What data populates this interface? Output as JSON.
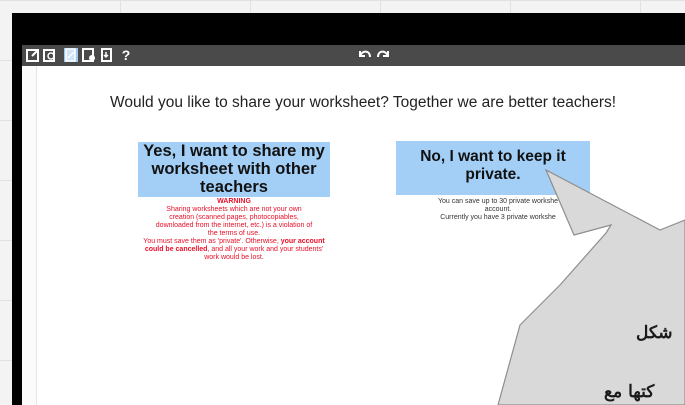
{
  "toolbar": {
    "icons": [
      "edit-icon",
      "preview-icon",
      "share-icon",
      "settings-icon",
      "export-icon"
    ],
    "help_label": "?",
    "undo_icon": "undo-icon",
    "redo_icon": "redo-icon"
  },
  "main": {
    "question": "Would you like to share your worksheet? Together we are better teachers!",
    "share_button": "Yes, I want to share my worksheet with other teachers",
    "private_button": "No, I want to keep it private.",
    "warning": {
      "title": "WARNING",
      "lines": [
        "Sharing worksheets which are not your own",
        "creation (scanned pages, photocopiables,",
        "downloaded from the internet, etc.) is a violation of",
        "the terms of use."
      ],
      "must_save": "You must save them as 'private'. Otherwise,",
      "cancelled_bold": "your account could be cancelled",
      "rest": ", and all your work and your students' work would be lost."
    },
    "private_info": {
      "line1": "You can save up to 30 private workshe",
      "line2": "account.",
      "line3": "Currently you have 3 private workshe"
    }
  },
  "bubble": {
    "line1": "شكل",
    "line2": "كتها مع"
  },
  "colors": {
    "toolbar": "#4a4a4a",
    "button": "#a3cff7",
    "warning": "#e8102a",
    "bubble": "#d9d9d9"
  }
}
